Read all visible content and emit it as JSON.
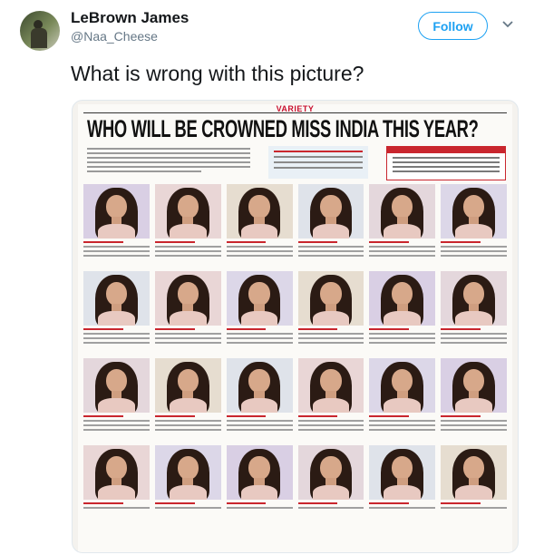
{
  "tweet": {
    "author_name": "LeBrown James",
    "author_handle": "@Naa_Cheese",
    "follow_label": "Follow",
    "text": "What is wrong with this picture?"
  },
  "newspaper": {
    "brand": "VARIETY",
    "headline": "WHO WILL BE CROWNED MISS INDIA THIS YEAR?"
  },
  "colors": {
    "twitter_blue": "#1da1f2",
    "text_primary": "#14171a",
    "text_secondary": "#657786",
    "newspaper_red": "#c9262e"
  },
  "icons": [
    "chevron-down-icon"
  ]
}
